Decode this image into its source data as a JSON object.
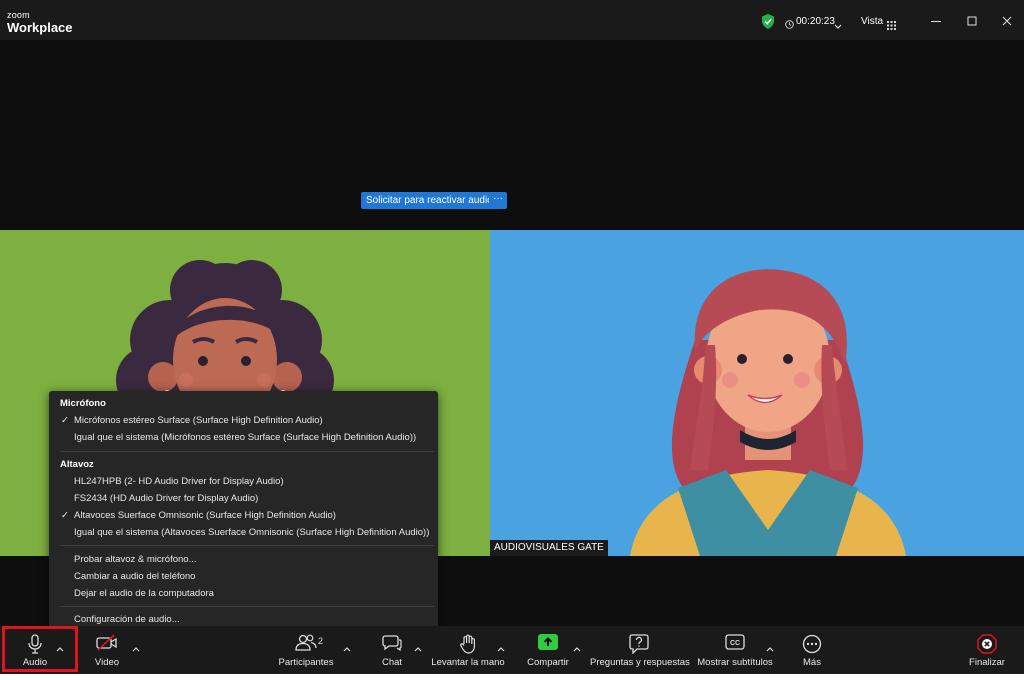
{
  "app": {
    "brand_small": "zoom",
    "brand_name": "Workplace"
  },
  "titlebar": {
    "timer": "00:20:23",
    "view_label": "Vista"
  },
  "stage": {
    "unmute_request_label": "Solicitar para reactivar audio",
    "more_label": "···",
    "participant_name": "AUDIOVISUALES GATE",
    "left_tile_color": "#7db040",
    "right_tile_color": "#4aa3e0"
  },
  "audio_menu": {
    "microphone_header": "Micrófono",
    "microphones": [
      {
        "label": "Micrófonos estéreo Surface (Surface High Definition Audio)",
        "selected": true
      },
      {
        "label": "Igual que el sistema (Micrófonos estéreo Surface (Surface High Definition Audio))",
        "selected": false
      }
    ],
    "speaker_header": "Altavoz",
    "speakers": [
      {
        "label": "HL247HPB (2- HD Audio Driver for Display Audio)",
        "selected": false
      },
      {
        "label": "FS2434 (HD Audio Driver for Display Audio)",
        "selected": false
      },
      {
        "label": "Altavoces Suerface Omnisonic (Surface High Definition Audio)",
        "selected": true
      },
      {
        "label": "Igual que el sistema (Altavoces Suerface Omnisonic (Surface High Definition Audio))",
        "selected": false
      }
    ],
    "actions": [
      "Probar altavoz & micrófono...",
      "Cambiar a audio del teléfono",
      "Dejar el audio de la computadora"
    ],
    "settings": "Configuración de audio...",
    "check_mark": "✓"
  },
  "toolbar": {
    "audio": "Audio",
    "video": "Video",
    "participants": "Participantes",
    "participants_count": "2",
    "chat": "Chat",
    "raise_hand": "Levantar la mano",
    "share": "Compartir",
    "qa": "Preguntas y respuestas",
    "captions": "Mostrar subtítulos",
    "more": "Más",
    "end": "Finalizar"
  },
  "colors": {
    "accent": "#1f77d6",
    "share_green": "#2ecc40",
    "highlight_red": "#e0141e",
    "end_red": "#e0141e"
  }
}
